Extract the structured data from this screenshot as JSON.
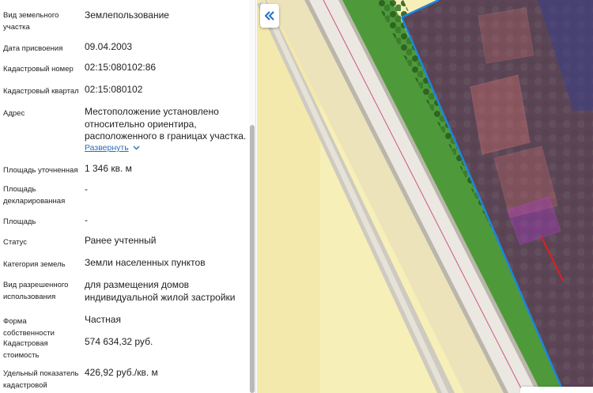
{
  "details": {
    "plot_kind_label": "Вид земельного участка",
    "plot_kind_value": "Землепользование",
    "assign_date_label": "Дата присвоения",
    "assign_date_value": "09.04.2003",
    "cadastral_number_label": "Кадастровый номер",
    "cadastral_number_value": "02:15:080102:86",
    "cadastral_block_label": "Кадастровый квартал",
    "cadastral_block_value": "02:15:080102",
    "address_label": "Адрес",
    "address_value": "Местоположение установлено относительно ориентира, расположенного в границах участка.",
    "address_expand": "Развернуть",
    "area_refined_label": "Площадь уточненная",
    "area_refined_value": "1 346 кв. м",
    "area_declared_label": "Площадь декларированная",
    "area_declared_value": "-",
    "area_label": "Площадь",
    "area_value": "-",
    "status_label": "Статус",
    "status_value": "Ранее учтенный",
    "land_category_label": "Категория земель",
    "land_category_value": "Земли населенных пунктов",
    "permitted_use_label": "Вид разрешенного использования",
    "permitted_use_value": "для размещения домов индивидуальной жилой застройки",
    "ownership_label": "Форма собственности",
    "ownership_value": "Частная",
    "cadastral_cost_label": "Кадастровая стоимость",
    "cadastral_cost_value": "574 634,32 руб.",
    "specific_indicator_label": "Удельный показатель кадастровой",
    "specific_indicator_value": "426,92 руб./кв. м"
  },
  "map": {
    "collapse_icon": "double-chevron-left-icon",
    "colors": {
      "sand": "#f7efb8",
      "road_edge": "#b9b4a8",
      "road_fill": "#e9e6df",
      "road_line": "#c9577e",
      "grass": "#4e9a3a",
      "trees": "#2f6a24",
      "parcel_zone": "#6e3f6e",
      "boundary_blue": "#1e86e0",
      "highlight_parcel": "#b03bd0",
      "arrow": "#e01e1e"
    }
  }
}
